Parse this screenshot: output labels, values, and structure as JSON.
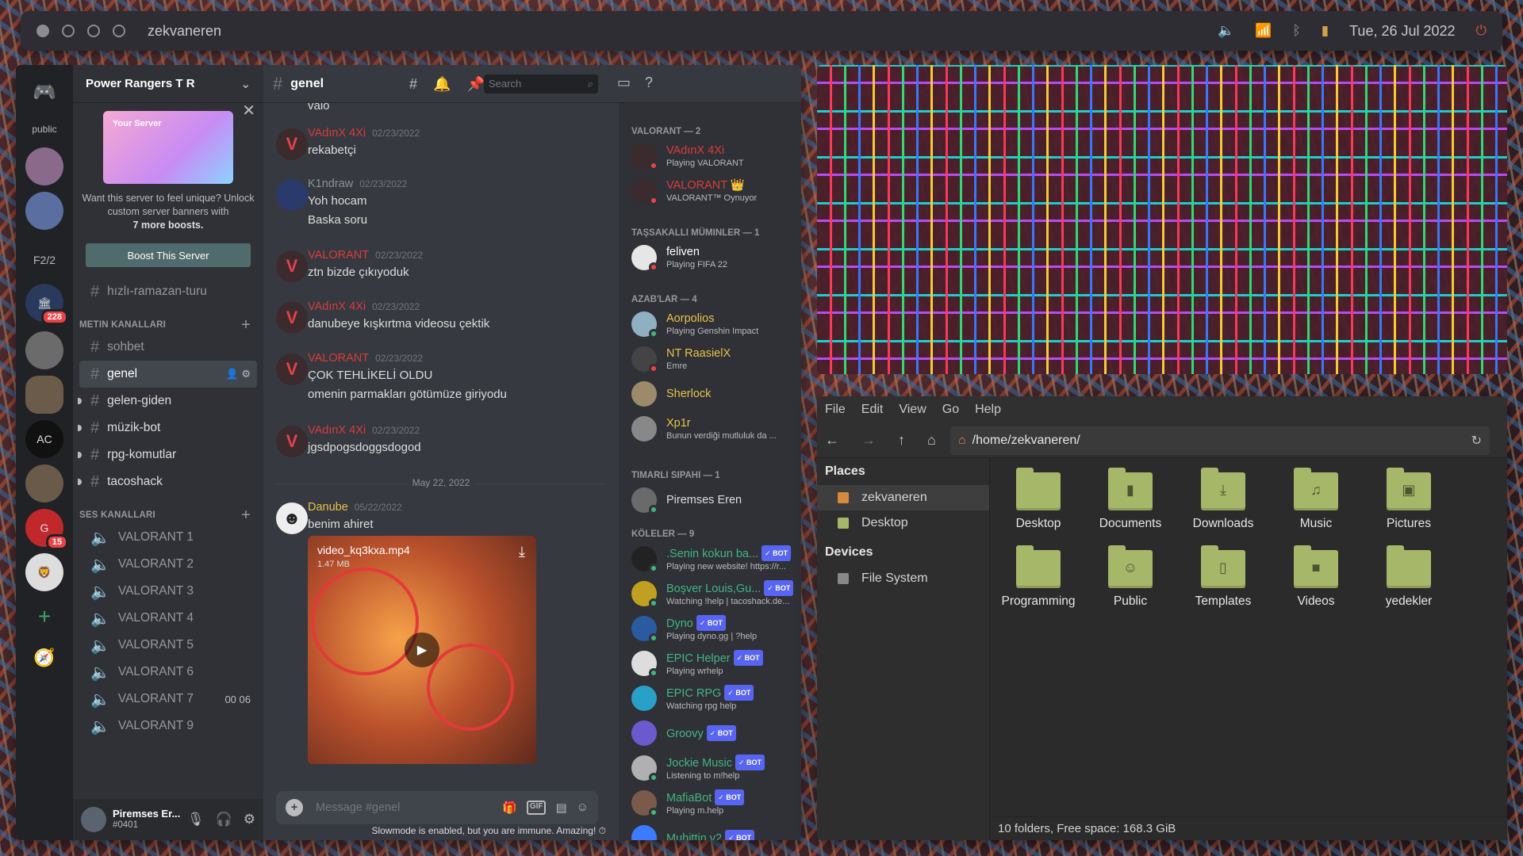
{
  "topbar": {
    "title": "zekvaneren",
    "date": "Tue, 26 Jul 2022"
  },
  "discord": {
    "guilds": {
      "public_label": "public",
      "f2_label": "F2/2",
      "badge_228": "228",
      "badge_15": "15"
    },
    "server_name": "Power Rangers T R",
    "boost": {
      "banner_label": "Your Server",
      "text1": "Want this server to feel unique? Unlock custom server banners with",
      "text2": "7 more boosts.",
      "button": "Boost This Server"
    },
    "top_channel": "hızlı-ramazan-turu",
    "text_category": "METIN KANALLARI",
    "text_channels": [
      "sohbet",
      "genel",
      "gelen-giden",
      "müzik-bot",
      "rpg-komutlar",
      "tacoshack"
    ],
    "voice_category": "SES KANALLARI",
    "voice_channels": [
      "VALORANT 1",
      "VALORANT 2",
      "VALORANT 3",
      "VALORANT 4",
      "VALORANT 5",
      "VALORANT 6",
      "VALORANT 7",
      "VALORANT 9"
    ],
    "voice_timer": "00  06",
    "user": {
      "name": "Piremses Er...",
      "tag": "#0401"
    },
    "channel_title": "genel",
    "search_placeholder": "Search",
    "messages": [
      {
        "author": "",
        "time": "",
        "lines": [
          "valo"
        ]
      },
      {
        "author": "VAdınX 4Xi",
        "time": "02/23/2022",
        "lines": [
          "rekabetçi"
        ]
      },
      {
        "author": "K1ndraw",
        "time": "02/23/2022",
        "lines": [
          "Yoh hocam",
          "Baska soru"
        ]
      },
      {
        "author": "VALORANT",
        "time": "02/23/2022",
        "lines": [
          "ztn bizde çıkıyoduk"
        ]
      },
      {
        "author": "VAdınX 4Xi",
        "time": "02/23/2022",
        "lines": [
          "danubeye kışkırtma videosu çektik"
        ]
      },
      {
        "author": "VALORANT",
        "time": "02/23/2022",
        "lines": [
          "ÇOK TEHLİKELİ OLDU",
          "omenin parmakları götümüze giriyodu"
        ]
      },
      {
        "author": "VAdınX 4Xi",
        "time": "02/23/2022",
        "lines": [
          "jgsdpogsdoggsdogod"
        ]
      }
    ],
    "date_divider": "May 22, 2022",
    "danube": {
      "author": "Danube",
      "time": "05/22/2022",
      "text": "benim ahiret",
      "video_name": "video_kq3kxa.mp4",
      "video_size": "1.47 MB"
    },
    "composer_placeholder": "Message #genel",
    "gif_label": "GIF",
    "slowmode": "Slowmode is enabled, but you are immune. Amazing!",
    "member_groups": [
      {
        "title": "VALORANT — 2",
        "members": [
          {
            "name": "VAdınX 4Xi",
            "status": "Playing VALORANT",
            "color": "#d83c3e",
            "bot": false
          },
          {
            "name": "VALORANT 👑",
            "status": "VALORANT™ Oynuyor",
            "color": "#d83c3e",
            "bot": false
          }
        ]
      },
      {
        "title": "TAŞSAKALLI MÜMINLER — 1",
        "members": [
          {
            "name": "feliven",
            "status": "Playing FIFA 22",
            "color": "#ffffff",
            "bot": false
          }
        ]
      },
      {
        "title": "AZAB'LAR — 4",
        "members": [
          {
            "name": "Aorpolios",
            "status": "Playing Genshin Impact",
            "color": "#e6c34a",
            "bot": false
          },
          {
            "name": "NT RaasielX",
            "status": "Emre",
            "color": "#e6c34a",
            "bot": false
          },
          {
            "name": "Sherlock",
            "status": "",
            "color": "#e6c34a",
            "bot": false
          },
          {
            "name": "Xp1r",
            "status": "Bunun verdiği mutluluk da ...",
            "color": "#e6c34a",
            "bot": false
          }
        ]
      },
      {
        "title": "TIMARLI SIPAHI — 1",
        "members": [
          {
            "name": "Piremses Eren",
            "status": "",
            "color": "#dcddde",
            "bot": false
          }
        ]
      },
      {
        "title": "KÖLELER — 9",
        "members": [
          {
            "name": ".Senin kokun ba...",
            "status": "Playing new website! https://r...",
            "color": "#43b581",
            "bot": true
          },
          {
            "name": "Boşver Louis,Gu...",
            "status": "Watching !help | tacoshack.de...",
            "color": "#43b581",
            "bot": true
          },
          {
            "name": "Dyno",
            "status": "Playing dyno.gg | ?help",
            "color": "#43b581",
            "bot": true
          },
          {
            "name": "EPIC Helper",
            "status": "Playing wrhelp",
            "color": "#43b581",
            "bot": true
          },
          {
            "name": "EPIC RPG",
            "status": "Watching rpg help",
            "color": "#43b581",
            "bot": true
          },
          {
            "name": "Groovy",
            "status": "",
            "color": "#43b581",
            "bot": true
          },
          {
            "name": "Jockie Music",
            "status": "Listening to m!help",
            "color": "#43b581",
            "bot": true
          },
          {
            "name": "MafiaBot",
            "status": "Playing m.help",
            "color": "#43b581",
            "bot": true
          },
          {
            "name": "Muhittin v2",
            "status": "",
            "color": "#43b581",
            "bot": true
          }
        ]
      }
    ],
    "bot_label": "✓ BOT"
  },
  "filemanager": {
    "menu": [
      "File",
      "Edit",
      "View",
      "Go",
      "Help"
    ],
    "path": "/home/zekvaneren/",
    "places_header": "Places",
    "places": [
      "zekvaneren",
      "Desktop"
    ],
    "devices_header": "Devices",
    "devices": [
      "File System"
    ],
    "folders": [
      {
        "name": "Desktop",
        "glyph": ""
      },
      {
        "name": "Documents",
        "glyph": "▮"
      },
      {
        "name": "Downloads",
        "glyph": "⤓"
      },
      {
        "name": "Music",
        "glyph": "♫"
      },
      {
        "name": "Pictures",
        "glyph": "▣"
      },
      {
        "name": "Programming",
        "glyph": ""
      },
      {
        "name": "Public",
        "glyph": "☺"
      },
      {
        "name": "Templates",
        "glyph": "▯"
      },
      {
        "name": "Videos",
        "glyph": "■"
      },
      {
        "name": "yedekler",
        "glyph": ""
      }
    ],
    "status": "10 folders, Free space: 168.3 GiB"
  }
}
